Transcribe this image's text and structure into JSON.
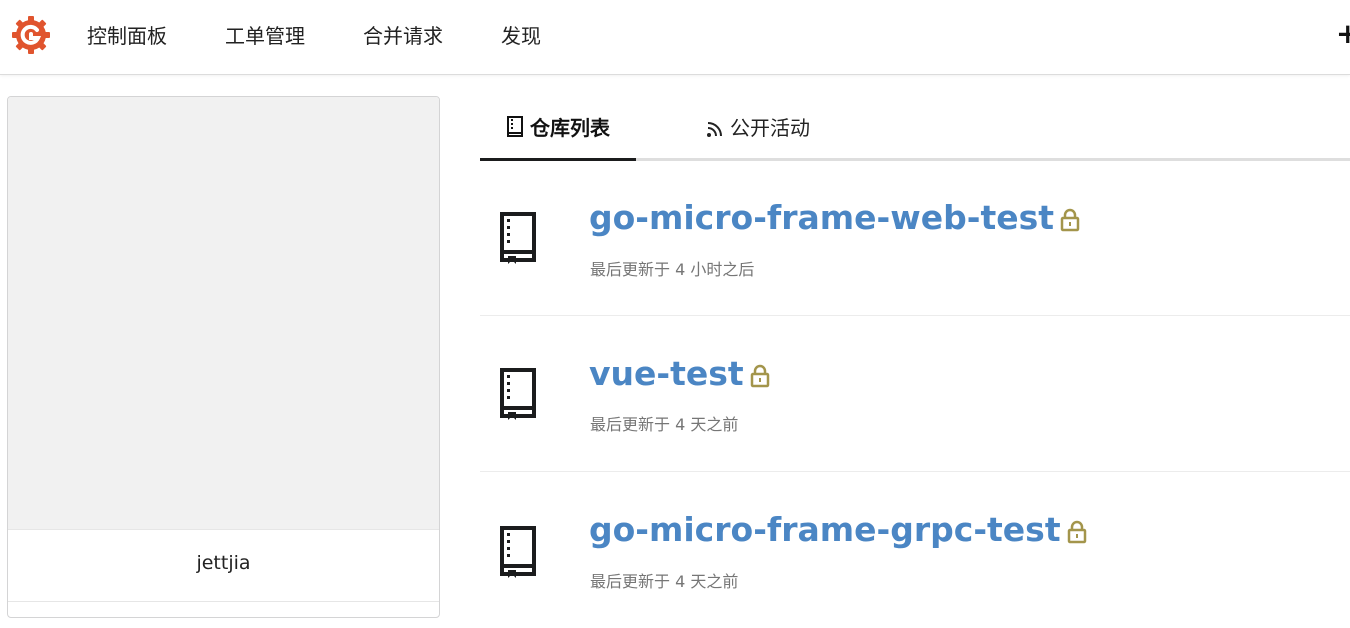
{
  "nav": {
    "items": [
      "控制面板",
      "工单管理",
      "合并请求",
      "发现"
    ],
    "plus_label": "+"
  },
  "profile": {
    "username": "jettjia"
  },
  "tabs": [
    {
      "label": "仓库列表",
      "icon": "repo-icon",
      "active": true
    },
    {
      "label": "公开活动",
      "icon": "rss-icon",
      "active": false
    }
  ],
  "repos": [
    {
      "name": "go-micro-frame-web-test",
      "updated": "最后更新于 4 小时之后",
      "private": true
    },
    {
      "name": "vue-test",
      "updated": "最后更新于 4 天之前",
      "private": true
    },
    {
      "name": "go-micro-frame-grpc-test",
      "updated": "最后更新于 4 天之前",
      "private": true
    }
  ],
  "colors": {
    "brand": "#e0542e",
    "link": "#4b86c4",
    "lock": "#a3954b",
    "meta": "#767676"
  }
}
